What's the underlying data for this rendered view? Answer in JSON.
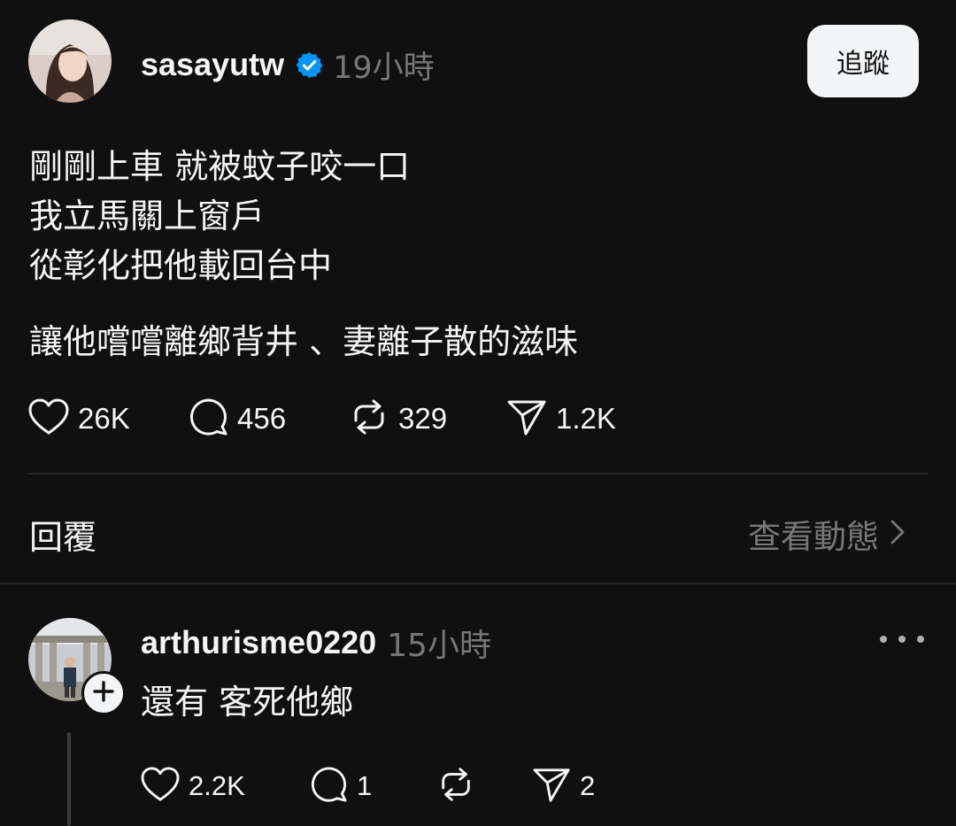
{
  "post": {
    "author": {
      "username": "sasayutw",
      "verified": true,
      "verified_icon": "verified-badge-icon",
      "verified_color": "#0095f6"
    },
    "timestamp": "19小時",
    "follow_button_label": "追蹤",
    "text_lines": [
      "剛剛上車 就被蚊子咬一口",
      "我立馬關上窗戶",
      "從彰化把他載回台中"
    ],
    "text_para2": "讓他嚐嚐離鄉背井 、妻離子散的滋味",
    "actions": {
      "like_count": "26K",
      "comment_count": "456",
      "repost_count": "329",
      "share_count": "1.2K"
    }
  },
  "replies_section": {
    "label": "回覆",
    "activity_link": "查看動態"
  },
  "reply": {
    "username": "arthurisme0220",
    "timestamp": "15小時",
    "text": "還有 客死他鄉",
    "actions": {
      "like_count": "2.2K",
      "comment_count": "1",
      "share_count": "2"
    }
  },
  "colors": {
    "background": "#101010",
    "text_primary": "#f3f5f7",
    "text_secondary": "#777777",
    "divider": "#262626",
    "follow_button_bg": "#f3f5f7"
  }
}
